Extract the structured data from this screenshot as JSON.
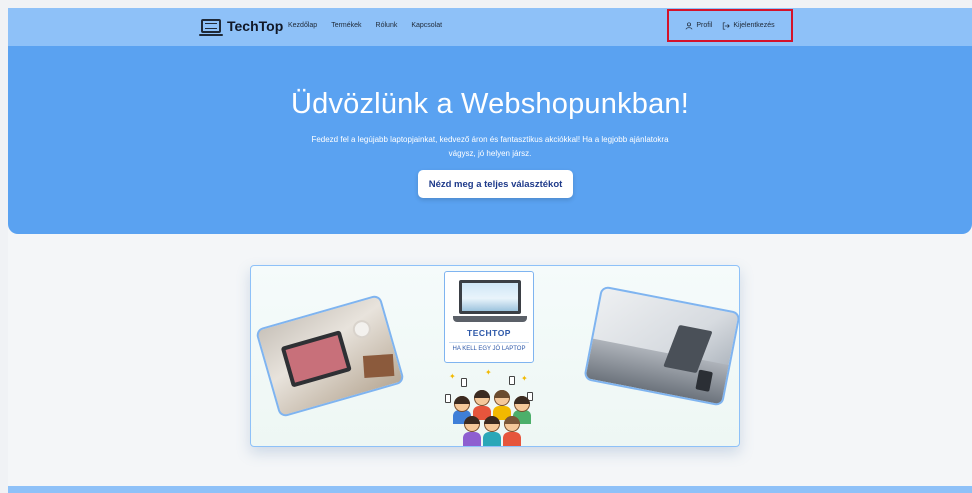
{
  "navbar": {
    "brand": "TechTop",
    "links": [
      "Kezdőlap",
      "Termékek",
      "Rólunk",
      "Kapcsolat"
    ],
    "profile_label": "Profil",
    "logout_label": "Kijelentkezés"
  },
  "hero": {
    "title": "Üdvözlünk a Webshopunkban!",
    "subtitle": "Fedezd fel a legújabb laptopjainkat, kedvező áron és fantasztikus akciókkal! Ha a legjobb ajánlatokra vágysz, jó helyen jársz.",
    "cta_label": "Nézd meg a teljes választékot"
  },
  "showcase": {
    "logo_name": "TECHTOP",
    "logo_slogan": "HA KELL EGY JÓ LAPTOP"
  },
  "colors": {
    "navbar": "#8ec1f8",
    "hero": "#5aa2f1",
    "highlight_border": "#d4122a"
  }
}
